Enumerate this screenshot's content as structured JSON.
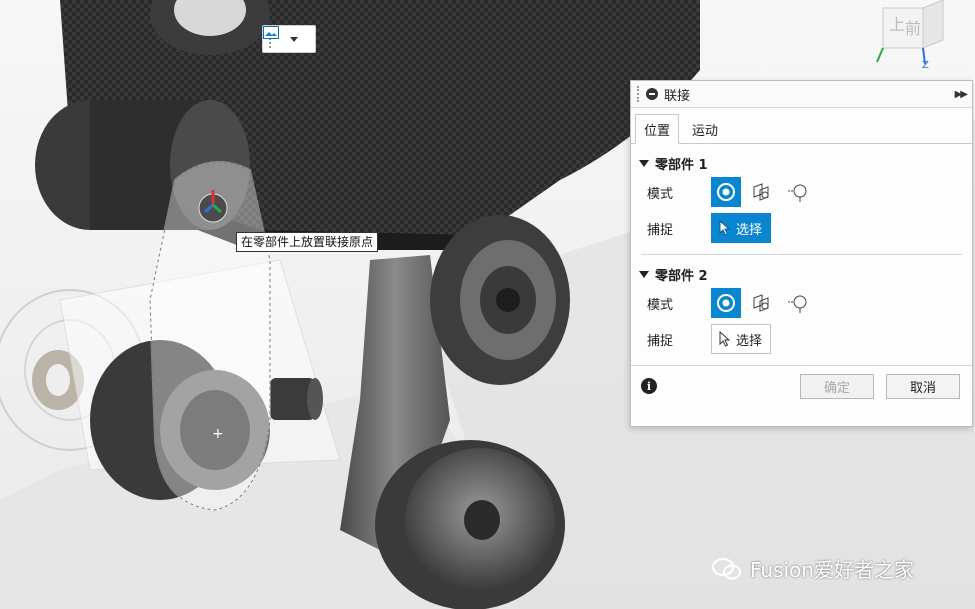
{
  "mini_toolbar": {
    "icon": "image-icon",
    "caret": "chevron-down-icon"
  },
  "viewcube": {
    "face_top_label": "上",
    "face_front_label": "前",
    "axis_label": "Z"
  },
  "tooltip": {
    "text": "在零部件上放置联接原点"
  },
  "dialog": {
    "title": "联接",
    "tabs": [
      {
        "label": "位置",
        "active": true
      },
      {
        "label": "运动",
        "active": false
      }
    ],
    "component1": {
      "header": "零部件 1",
      "mode_label": "模式",
      "snap_label": "捕捉",
      "select_label": "选择",
      "select_active": true
    },
    "component2": {
      "header": "零部件 2",
      "mode_label": "模式",
      "snap_label": "捕捉",
      "select_label": "选择",
      "select_active": false
    },
    "ok_label": "确定",
    "cancel_label": "取消"
  },
  "watermark": {
    "text": "Fusion爱好者之家"
  },
  "colors": {
    "accent": "#0a86d0",
    "carbon": "#2c2c2c",
    "metal": "#5a5a5a"
  }
}
